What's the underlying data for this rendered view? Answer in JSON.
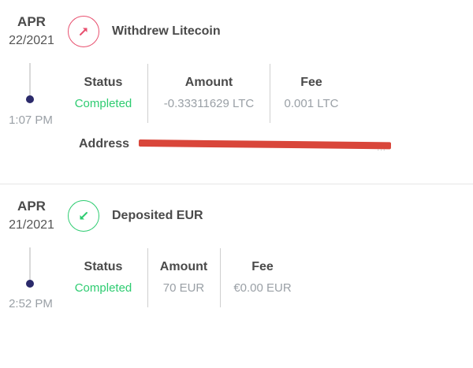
{
  "transactions": [
    {
      "date_month": "APR",
      "date_day": "22/2021",
      "title": "Withdrew Litecoin",
      "icon": "arrow-up-right-icon",
      "time": "1:07 PM",
      "status_label": "Status",
      "status_value": "Completed",
      "amount_label": "Amount",
      "amount_value": "-0.33311629 LTC",
      "fee_label": "Fee",
      "fee_value": "0.001 LTC",
      "address_label": "Address",
      "address_value": "..."
    },
    {
      "date_month": "APR",
      "date_day": "21/2021",
      "title": "Deposited EUR",
      "icon": "arrow-down-left-icon",
      "time": "2:52 PM",
      "status_label": "Status",
      "status_value": "Completed",
      "amount_label": "Amount",
      "amount_value": "70 EUR",
      "fee_label": "Fee",
      "fee_value": "€0.00 EUR"
    }
  ],
  "colors": {
    "withdraw_accent": "#e8506f",
    "deposit_accent": "#2ecc71",
    "status_completed": "#2ecc71",
    "timeline_dot": "#2b2a6b",
    "redaction": "#d9463a"
  }
}
